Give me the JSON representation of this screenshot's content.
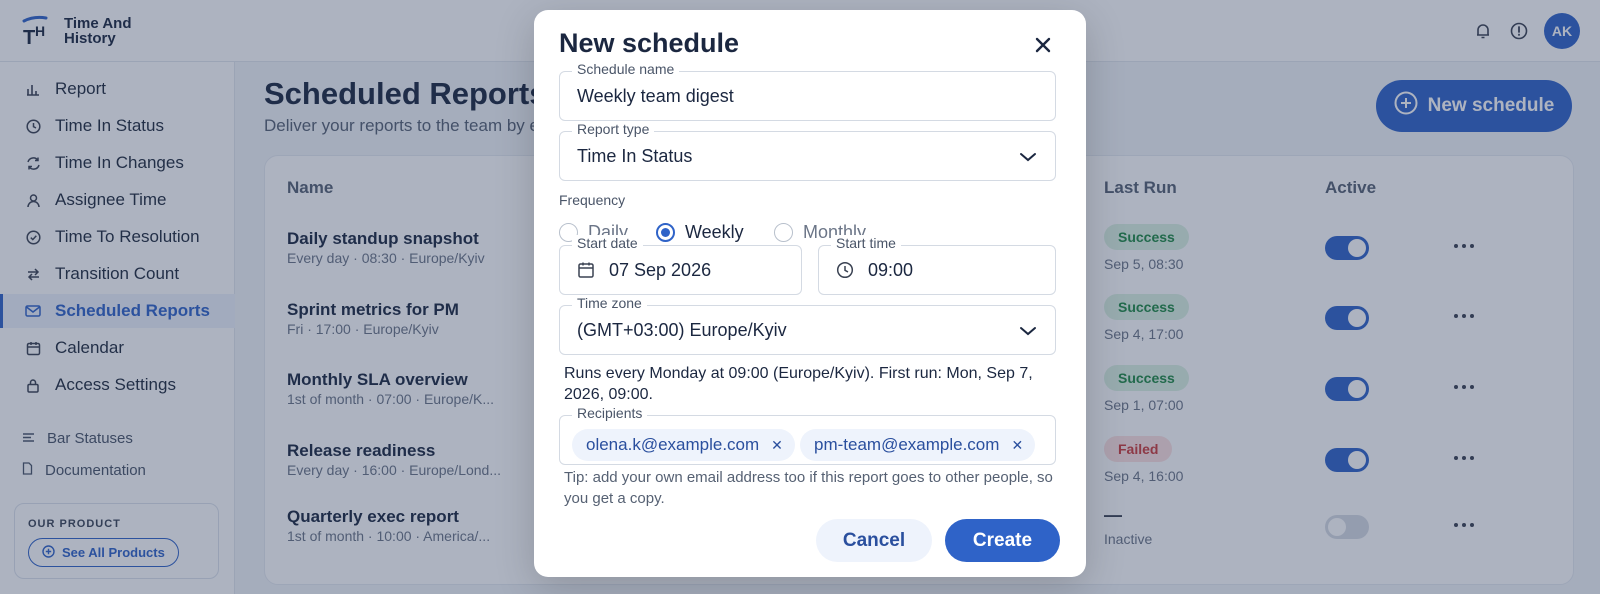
{
  "app": {
    "name_line1": "Time And",
    "name_line2": "History",
    "logo_letters": "TH",
    "user_initials": "AK"
  },
  "icons": {
    "bell": "bell-icon",
    "info": "info-icon",
    "close": "close-icon",
    "chevron": "chevron-down-icon",
    "calendar": "calendar-icon",
    "clock": "clock-icon",
    "plus": "plus-circle-icon",
    "more": "more-horizontal-icon"
  },
  "colors": {
    "accent": "#2f63c8",
    "success": "#1f8a45",
    "failed": "#cc3b3b"
  },
  "sidebar": {
    "items": [
      {
        "label": "Report",
        "icon": "bar-chart-icon"
      },
      {
        "label": "Time In Status",
        "icon": "clock-icon"
      },
      {
        "label": "Time In Changes",
        "icon": "refresh-icon"
      },
      {
        "label": "Assignee Time",
        "icon": "user-icon"
      },
      {
        "label": "Time To Resolution",
        "icon": "check-circle-icon"
      },
      {
        "label": "Transition Count",
        "icon": "transfer-icon"
      },
      {
        "label": "Scheduled Reports",
        "icon": "mail-icon",
        "active": true
      },
      {
        "label": "Calendar",
        "icon": "calendar-icon"
      },
      {
        "label": "Access Settings",
        "icon": "lock-icon"
      }
    ],
    "sub_items": [
      {
        "label": "Bar Statuses",
        "icon": "list-icon"
      },
      {
        "label": "Documentation",
        "icon": "document-icon"
      }
    ],
    "promo": {
      "title": "OUR PRODUCT",
      "button": "See All Products"
    }
  },
  "main": {
    "title": "Scheduled Reports",
    "subtitle": "Deliver your reports to the team by e",
    "new_button": "New schedule",
    "columns": {
      "name": "Name",
      "last_run": "Last Run",
      "active": "Active"
    },
    "rows": [
      {
        "name": "Daily standup snapshot",
        "meta": "Every day · 08:30 · Europe/Kyiv",
        "status": "Success",
        "status_kind": "success",
        "run_time": "Sep 5, 08:30",
        "active": true
      },
      {
        "name": "Sprint metrics for PM",
        "meta": "Fri · 17:00 · Europe/Kyiv",
        "status": "Success",
        "status_kind": "success",
        "run_time": "Sep 4, 17:00",
        "active": true
      },
      {
        "name": "Monthly SLA overview",
        "meta": "1st of month · 07:00 · Europe/K...",
        "status": "Success",
        "status_kind": "success",
        "run_time": "Sep 1, 07:00",
        "active": true
      },
      {
        "name": "Release readiness",
        "meta": "Every day · 16:00 · Europe/Lond...",
        "status": "Failed",
        "status_kind": "failed",
        "run_time": "Sep 4, 16:00",
        "active": true
      },
      {
        "name": "Quarterly exec report",
        "meta": "1st of month · 10:00 · America/...",
        "status": "—",
        "status_kind": "none",
        "run_time": "Inactive",
        "active": false
      }
    ]
  },
  "modal": {
    "title": "New schedule",
    "schedule_name": {
      "label": "Schedule name",
      "value": "Weekly team digest"
    },
    "report_type": {
      "label": "Report type",
      "value": "Time In Status"
    },
    "frequency": {
      "label": "Frequency",
      "options": [
        "Daily",
        "Weekly",
        "Monthly"
      ],
      "selected": "Weekly"
    },
    "start_date": {
      "label": "Start date",
      "value": "07 Sep 2026"
    },
    "start_time": {
      "label": "Start time",
      "value": "09:00"
    },
    "time_zone": {
      "label": "Time zone",
      "value": "(GMT+03:00) Europe/Kyiv"
    },
    "summary": "Runs every Monday at 09:00 (Europe/Kyiv). First run: Mon, Sep 7, 2026, 09:00.",
    "recipients": {
      "label": "Recipients",
      "chips": [
        "olena.k@example.com",
        "pm-team@example.com"
      ],
      "remove_glyph": "✕"
    },
    "tip": "Tip: add your own email address too if this report goes to other people, so you get a copy.",
    "cancel": "Cancel",
    "create": "Create"
  }
}
